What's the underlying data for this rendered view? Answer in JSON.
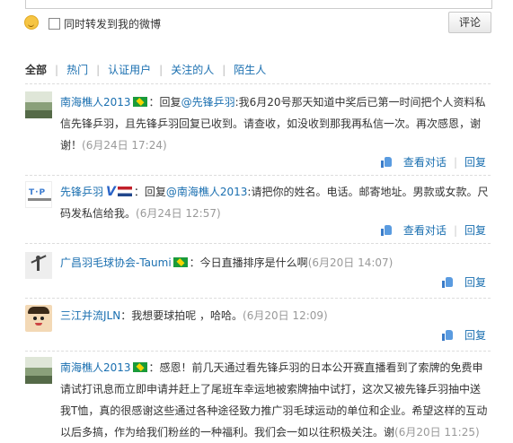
{
  "composer": {
    "repost_label": "同时转发到我的微博",
    "submit_label": "评论"
  },
  "filters": [
    {
      "label": "全部",
      "active": true
    },
    {
      "label": "热门",
      "active": false
    },
    {
      "label": "认证用户",
      "active": false
    },
    {
      "label": "关注的人",
      "active": false
    },
    {
      "label": "陌生人",
      "active": false
    }
  ],
  "comments": [
    {
      "author": "南海樵人2013",
      "flag": "brazil",
      "text_pre": "：回复",
      "mention": "@先锋乒羽",
      "text": ":我6月20号那天知道中奖后已第一时间把个人资料私信先锋乒羽，且先锋乒羽回复已收到。请查收，如没收到那我再私信一次。再次感恩，谢谢！",
      "time": "(6月24日 17:24)",
      "show_conversation": "查看对话",
      "reply": "回复"
    },
    {
      "author": "先锋乒羽",
      "verified": "V",
      "flag": "netherlands",
      "text_pre": "：回复",
      "mention": "@南海樵人2013",
      "text": ":请把你的姓名。电话。邮寄地址。男款或女款。尺码发私信给我。",
      "time": "(6月24日 12:57)",
      "show_conversation": "查看对话",
      "reply": "回复"
    },
    {
      "author": "广昌羽毛球协会-Taumi",
      "flag": "brazil",
      "text": "：今日直播排序是什么啊",
      "time": "(6月20日 14:07)",
      "reply": "回复"
    },
    {
      "author": "三江并流JLN",
      "text": "：我想要球拍呢 ，哈哈。",
      "time": "(6月20日 12:09)",
      "reply": "回复"
    },
    {
      "author": "南海樵人2013",
      "flag": "brazil",
      "text": "：感恩！前几天通过看先锋乒羽的日本公开赛直播看到了索牌的免费申请试打讯息而立即申请并赶上了尾班车幸运地被索牌抽中试打，这次又被先锋乒羽抽中送我T恤，真的很感谢这些通过各种途径致力推广羽毛球运动的单位和企业。希望这样的互动以后多搞，作为给我们粉丝的一种福利。我们会一如以往积极关注。谢",
      "time": "(6月20日 11:25)"
    }
  ]
}
